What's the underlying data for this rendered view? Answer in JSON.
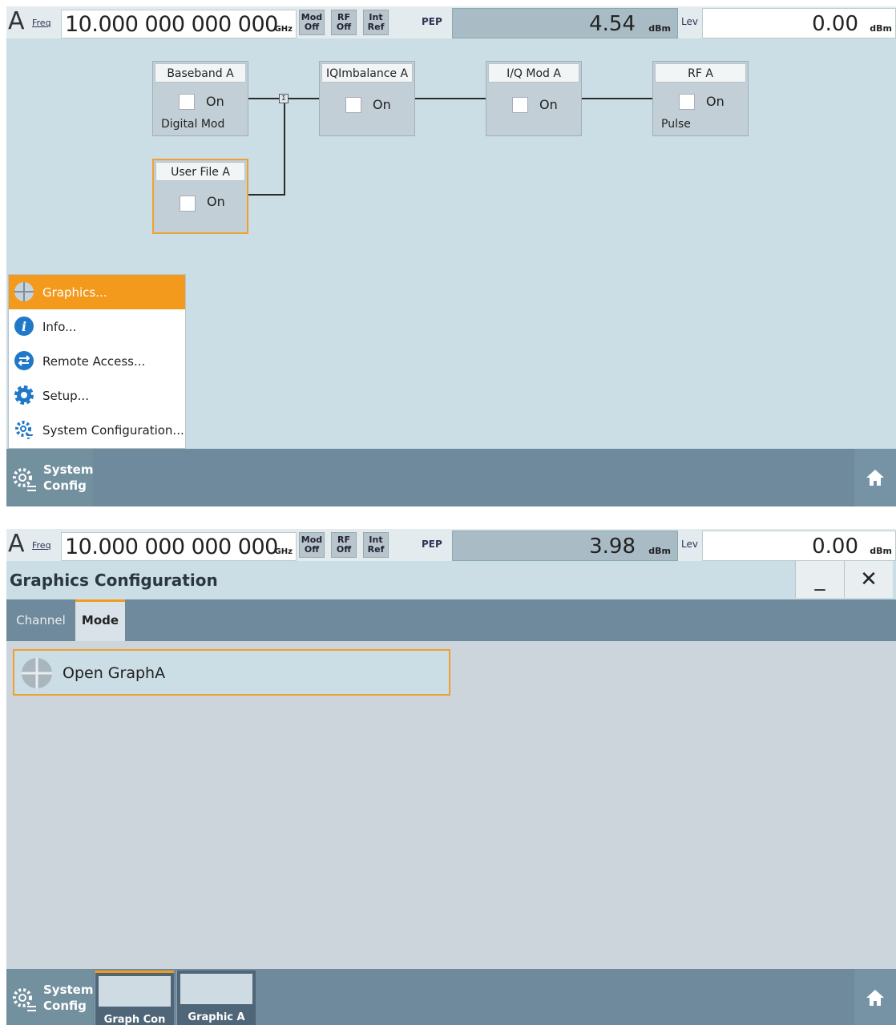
{
  "status_bar_1": {
    "channel": "A",
    "freq_label": "Freq",
    "freq_value": "10.000 000 000 000",
    "freq_unit": "GHz",
    "buttons": [
      {
        "top": "Mod",
        "bottom": "Off"
      },
      {
        "top": "RF",
        "bottom": "Off"
      },
      {
        "top": "Int",
        "bottom": "Ref"
      }
    ],
    "pep_label": "PEP",
    "pep_value": "4.54",
    "pep_unit": "dBm",
    "lev_label": "Lev",
    "lev_value": "0.00",
    "lev_unit": "dBm"
  },
  "diagram": {
    "baseband": {
      "title": "Baseband A",
      "state": "On",
      "sub": "Digital Mod"
    },
    "iq_imbalance": {
      "title": "IQImbalance A",
      "state": "On"
    },
    "iq_mod": {
      "title": "I/Q Mod A",
      "state": "On"
    },
    "rf": {
      "title": "RF A",
      "state": "On",
      "sub": "Pulse"
    },
    "user_file": {
      "title": "User File A",
      "state": "On"
    },
    "junction": "Σ"
  },
  "menu": {
    "items": [
      {
        "label": "Graphics...",
        "icon": "graphics-icon"
      },
      {
        "label": "Info...",
        "icon": "info-icon"
      },
      {
        "label": "Remote Access...",
        "icon": "remote-access-icon"
      },
      {
        "label": "Setup...",
        "icon": "setup-gear-icon"
      },
      {
        "label": "System Configuration...",
        "icon": "system-config-icon"
      }
    ],
    "highlight_color": "#f39a1d"
  },
  "taskbar_1": {
    "system_label_1": "System",
    "system_label_2": "Config"
  },
  "status_bar_2": {
    "channel": "A",
    "freq_label": "Freq",
    "freq_value": "10.000 000 000 000",
    "freq_unit": "GHz",
    "buttons": [
      {
        "top": "Mod",
        "bottom": "Off"
      },
      {
        "top": "RF",
        "bottom": "Off"
      },
      {
        "top": "Int",
        "bottom": "Ref"
      }
    ],
    "pep_label": "PEP",
    "pep_value": "3.98",
    "pep_unit": "dBm",
    "lev_label": "Lev",
    "lev_value": "0.00",
    "lev_unit": "dBm"
  },
  "dialog": {
    "title": "Graphics Configuration",
    "minimize": "_",
    "close": "✕",
    "tabs": [
      "Channel",
      "Mode"
    ],
    "active_tab": "Mode",
    "open_button": "Open GraphA"
  },
  "taskbar_2": {
    "system_label_1": "System",
    "system_label_2": "Config",
    "thumbnails": [
      "Graph Con",
      "Graphic A"
    ]
  }
}
